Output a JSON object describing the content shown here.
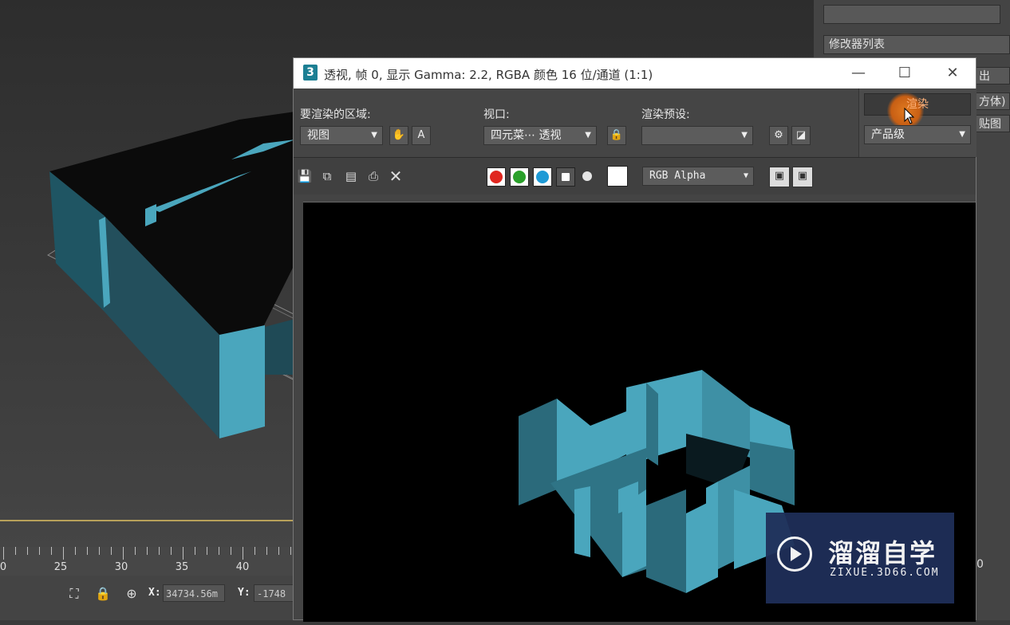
{
  "viewport": {
    "label": "透视"
  },
  "command_panel": {
    "modifier_list": "修改器列表",
    "partial_labels": [
      "出",
      "方体)",
      "贴图"
    ]
  },
  "ruler": {
    "labels": [
      "0",
      "25",
      "30",
      "35",
      "40"
    ],
    "right_label": "0"
  },
  "statusbar": {
    "x_label": "X:",
    "x_value": "34734.56m",
    "y_label": "Y:",
    "y_value": "-1748"
  },
  "render_window": {
    "title": "透视, 帧 0, 显示 Gamma: 2.2, RGBA 颜色 16 位/通道 (1:1)",
    "app_icon": "3",
    "controls": {
      "minimize": "—",
      "maximize": "☐",
      "close": "✕"
    },
    "area_label": "要渲染的区域:",
    "area_value": "视图",
    "viewport_label": "视口:",
    "viewport_value": "四元菜⋯ 透视",
    "preset_label": "渲染预设:",
    "preset_value": "",
    "render_button": "渲染",
    "quality_value": "产品级",
    "channel_display": "RGB Alpha",
    "channels": [
      {
        "name": "red",
        "color": "#e0261f"
      },
      {
        "name": "green",
        "color": "#2aa02a"
      },
      {
        "name": "blue",
        "color": "#1e9ad6"
      }
    ]
  },
  "watermark": {
    "title": "溜溜自学",
    "subtitle": "ZIXUE.3D66.COM"
  },
  "colors": {
    "model_cyan": "#4aa6bd",
    "accent_orange": "#e07a20"
  }
}
